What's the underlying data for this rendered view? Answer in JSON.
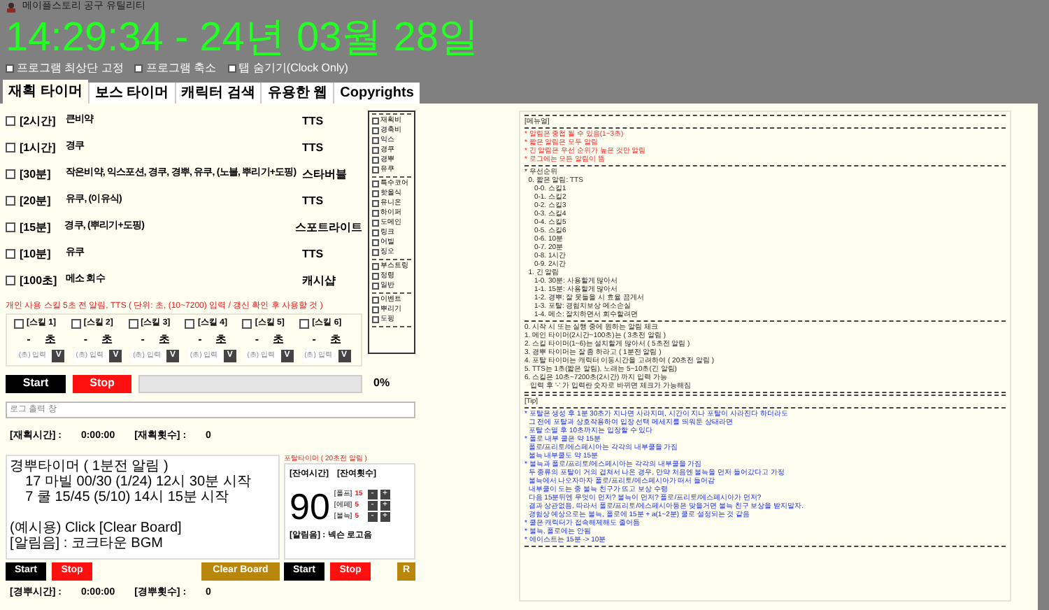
{
  "window": {
    "title": "메이플스토리 공구 유틸리티"
  },
  "clock": "14:29:34 - 24년 03월 28일",
  "options": [
    {
      "label": "프로그램 최상단 고정",
      "checked": false
    },
    {
      "label": "프로그램 축소",
      "checked": false
    },
    {
      "label": "탭 숨기기(Clock Only)",
      "checked": false
    }
  ],
  "tabs": [
    {
      "label": "재획 타이머",
      "selected": true
    },
    {
      "label": "보스 타이머",
      "selected": false
    },
    {
      "label": "캐릭터 검색",
      "selected": false
    },
    {
      "label": "유용한 웹",
      "selected": false
    },
    {
      "label": "Copyrights",
      "selected": false
    }
  ],
  "timers": [
    {
      "checked": false,
      "duration": "[2시간]",
      "items": "큰비약",
      "sound": "TTS"
    },
    {
      "checked": false,
      "duration": "[1시간]",
      "items": "경쿠",
      "sound": "TTS"
    },
    {
      "checked": false,
      "duration": "[30분]",
      "items": "작은비약, 익스포션, 경쿠, 경뿌, 유쿠, (노블, 뿌리기+도핑)",
      "sound": "스타버블"
    },
    {
      "checked": false,
      "duration": "[20분]",
      "items": "유쿠, (이유식)",
      "sound": "TTS"
    },
    {
      "checked": false,
      "duration": "[15분]",
      "items": "경쿠, (뿌리기+도핑)",
      "sound": "스포트라이트"
    },
    {
      "checked": false,
      "duration": "[10분]",
      "items": "유쿠",
      "sound": "TTS"
    },
    {
      "checked": false,
      "duration": "[100초]",
      "items": "메소 회수",
      "sound": "캐시샵"
    }
  ],
  "buff_groups": [
    [
      {
        "label": "재획비",
        "checked": false
      },
      {
        "label": "경축비",
        "checked": false
      },
      {
        "label": "익스",
        "checked": false
      },
      {
        "label": "경쿠",
        "checked": false
      },
      {
        "label": "경뿌",
        "checked": false
      },
      {
        "label": "유쿠",
        "checked": false
      }
    ],
    [
      {
        "label": "특수코어",
        "checked": false
      },
      {
        "label": "핫올식",
        "checked": false
      },
      {
        "label": "유니온",
        "checked": false
      },
      {
        "label": "하이퍼",
        "checked": false
      },
      {
        "label": "도메인",
        "checked": false
      },
      {
        "label": "링크",
        "checked": false
      },
      {
        "label": "어빌",
        "checked": false
      },
      {
        "label": "징오",
        "checked": false
      }
    ],
    [
      {
        "label": "부스트링",
        "checked": false
      },
      {
        "label": "정령",
        "checked": false
      },
      {
        "label": "일반",
        "checked": false
      }
    ],
    [
      {
        "label": "이벤트",
        "checked": false
      },
      {
        "label": "뿌리기",
        "checked": false
      },
      {
        "label": "도핑",
        "checked": false
      }
    ]
  ],
  "skill_alert": {
    "title": "개인 사용 스킬 5초 전 알림, TTS ( 단위: 초, (10~7200) 입력 / 갱신 확인 후 사용할 것 )",
    "skills": [
      {
        "label": "[스킬 1]",
        "checked": false,
        "value": "-",
        "unit": "초",
        "placeholder": "(초) 입력",
        "button": "V"
      },
      {
        "label": "[스킬 2]",
        "checked": false,
        "value": "-",
        "unit": "초",
        "placeholder": "(초) 입력",
        "button": "V"
      },
      {
        "label": "[스킬 3]",
        "checked": false,
        "value": "-",
        "unit": "초",
        "placeholder": "(초) 입력",
        "button": "V"
      },
      {
        "label": "[스킬 4]",
        "checked": false,
        "value": "-",
        "unit": "초",
        "placeholder": "(초) 입력",
        "button": "V"
      },
      {
        "label": "[스킬 5]",
        "checked": false,
        "value": "-",
        "unit": "초",
        "placeholder": "(초) 입력",
        "button": "V"
      },
      {
        "label": "[스킬 6]",
        "checked": false,
        "value": "-",
        "unit": "초",
        "placeholder": "(초) 입력",
        "button": "V"
      }
    ]
  },
  "run": {
    "start": "Start",
    "stop": "Stop",
    "progress": {
      "level": 0
    },
    "percent": "0%"
  },
  "log": {
    "placeholder": "로그 출력 창"
  },
  "hunt_stats": [
    {
      "label": "[재획시간] :",
      "value": "0:00:00"
    },
    {
      "label": "[재획횟수] :",
      "value": "0"
    }
  ],
  "board": {
    "paragraphs": [
      [
        "경뿌타이머 ( 1분전 알림 )",
        "    17 마빌 00/30 (1/24) 12시 30분 시작",
        "    7 쿨 15/45 (5/10) 14시 15분 시작"
      ],
      [
        "(예시용) Click [Clear Board]",
        "[알림음] : 코크타운 BGM"
      ]
    ],
    "start": "Start",
    "stop": "Stop",
    "clear": "Clear Board"
  },
  "portal": {
    "title": "포탈타이머 ( 20초전 알림 )",
    "time_label": "[잔여시간]",
    "count_label": "[잔여횟수]",
    "time": "90",
    "counters": [
      {
        "label": "[폴프]",
        "value": "15",
        "minus": "-",
        "plus": "+"
      },
      {
        "label": "[에페]",
        "value": "5",
        "minus": "-",
        "plus": "+"
      },
      {
        "label": "[불늑]",
        "value": "5",
        "minus": "-",
        "plus": "+"
      }
    ],
    "sound": "[알림음] : 넥슨 로고음",
    "start": "Start",
    "stop": "Stop",
    "reset": "R"
  },
  "bottom_stats": [
    {
      "label": "[경뿌시간] :",
      "value": "0:00:00"
    },
    {
      "label": "[경뿌횟수] :",
      "value": "0"
    }
  ],
  "manual": [
    {
      "lines": [
        {
          "kind": "normal",
          "text": "[메뉴얼]"
        }
      ]
    },
    {
      "lines": [
        {
          "kind": "warning",
          "text": "* 알림은 중첩 될 수 있음(1~3초)"
        },
        {
          "kind": "warning",
          "text": "* 짧은 알림은 모두 알림"
        },
        {
          "kind": "warning",
          "text": "* 긴 알림은 우선 순위가 높은 것만 알림"
        },
        {
          "kind": "warning",
          "text": "* 로그에는 모든 알림이 뜸"
        }
      ]
    },
    {
      "lines": [
        {
          "kind": "normal",
          "text": "* 우선순위"
        },
        {
          "kind": "normal",
          "text": "  0. 짧은 알림: TTS"
        },
        {
          "kind": "normal",
          "text": "     0-0. 스킬1"
        },
        {
          "kind": "normal",
          "text": "     0-1. 스킬2"
        },
        {
          "kind": "normal",
          "text": "     0-2. 스킬3"
        },
        {
          "kind": "normal",
          "text": "     0-3. 스킬4"
        },
        {
          "kind": "normal",
          "text": "     0-4. 스킬5"
        },
        {
          "kind": "normal",
          "text": "     0-5. 스킬6"
        },
        {
          "kind": "normal",
          "text": "     0-6. 10분"
        },
        {
          "kind": "normal",
          "text": "     0-7. 20분"
        },
        {
          "kind": "normal",
          "text": "     0-8. 1시간"
        },
        {
          "kind": "normal",
          "text": "     0-9. 2시간"
        },
        {
          "kind": "normal",
          "text": "  1. 긴 알림"
        },
        {
          "kind": "normal",
          "text": "     1-0. 30분: 사용할게 많아서"
        },
        {
          "kind": "normal",
          "text": "     1-1. 15분: 사용할게 많아서"
        },
        {
          "kind": "normal",
          "text": "     1-2. 경뿌: 잘 못들을 시 효율 끔게서"
        },
        {
          "kind": "normal",
          "text": "     1-3. 포탈: 경험치보상 메소손실"
        },
        {
          "kind": "normal",
          "text": "     1-4. 메소: 잘치하면서 회수할려면"
        }
      ]
    },
    {
      "lines": [
        {
          "kind": "normal",
          "text": "0. 시작 시 또는 실행 중에 원하는 알림 체크"
        },
        {
          "kind": "normal",
          "text": "1. 메인 타이머(2시간~100초)는 ( 3초전 알림 )"
        },
        {
          "kind": "normal",
          "text": "2. 스킬 타이머(1~6)는 설치할게 많아서 ( 5초전 알림 )"
        },
        {
          "kind": "normal",
          "text": "3. 경뿌 타이머는 잘 좀 하라고 ( 1분전 알림 )"
        },
        {
          "kind": "normal",
          "text": "4. 포탈 타이머는 캐릭터 이동시간을 고려하여 ( 20초전 알림 )"
        },
        {
          "kind": "normal",
          "text": "5. TTS는 1초(짧은 알림), 노래는 5~10초(긴 알림)"
        },
        {
          "kind": "normal",
          "text": "6. 스킬은 10초~7200초(2시간) 까지 입력 가능"
        },
        {
          "kind": "normal",
          "text": "   입력 후 '-' 가 입력란 숫자로 바뀌면 체크가 가능해짐"
        }
      ]
    },
    {
      "lines": [
        {
          "kind": "normal",
          "text": "[Tip]"
        }
      ]
    },
    {
      "lines": [
        {
          "kind": "tip",
          "text": "* 포탈은 생성 후 1분 30초가 지나면 사라지며, 시간이 지나 포탈이 사라진다 하더라도"
        },
        {
          "kind": "tip",
          "text": "  그 전에 포탈과 상호작용하여 입장 선택 메세지를 띄워둔 상태라면"
        },
        {
          "kind": "tip",
          "text": "  포탈 소멸 후 10초까지는 입장할 수 있다"
        },
        {
          "kind": "tip",
          "text": "* 폴로 내부 쿨은 약 15분"
        },
        {
          "kind": "tip",
          "text": "  폴로/프리토/에스페시아는 각각의 내부쿨을 가짐"
        },
        {
          "kind": "tip",
          "text": "  불늑 내부쿨도 약 15분"
        },
        {
          "kind": "tip",
          "text": "* 불늑과 폴로/프리토/에스페시아는 각각의 내부쿨을 가짐"
        },
        {
          "kind": "tip",
          "text": "  두 종류의 포탈이 거의 겹쳐서 나온 경우, 만약 처음엔 불늑을 먼저 들어갔다고 가정"
        },
        {
          "kind": "tip",
          "text": "  불늑에서 나오자마자 폴로/프리토/에스페시아가 떠서 들어감"
        },
        {
          "kind": "tip",
          "text": "  내부쿨이 도는 중 불늑 친구가 뜨고 보상 수령"
        },
        {
          "kind": "tip",
          "text": "  다음 15분뒤엔 무엇이 먼저? 불늑이 먼저? 폴로/프리토/에스페시아가 먼저?"
        },
        {
          "kind": "tip",
          "text": "  결과 상관없음, 따라서 폴로/프리토/에스페시아등은 맞을거면 불늑 친구 보상을 받지말자."
        },
        {
          "kind": "tip",
          "text": "  경험상 예상으로는 불늑, 폴로에 15분 + a(1~2분) 쿨로 설정되는 것 같음"
        },
        {
          "kind": "tip",
          "text": "* 쿨은 캐릭터가 접속해제해도 줄어듬"
        },
        {
          "kind": "tip",
          "text": "* 불늑, 폴로에는 안됨"
        },
        {
          "kind": "tip",
          "text": "* 에이스트는 15분 -> 10분"
        }
      ]
    }
  ]
}
